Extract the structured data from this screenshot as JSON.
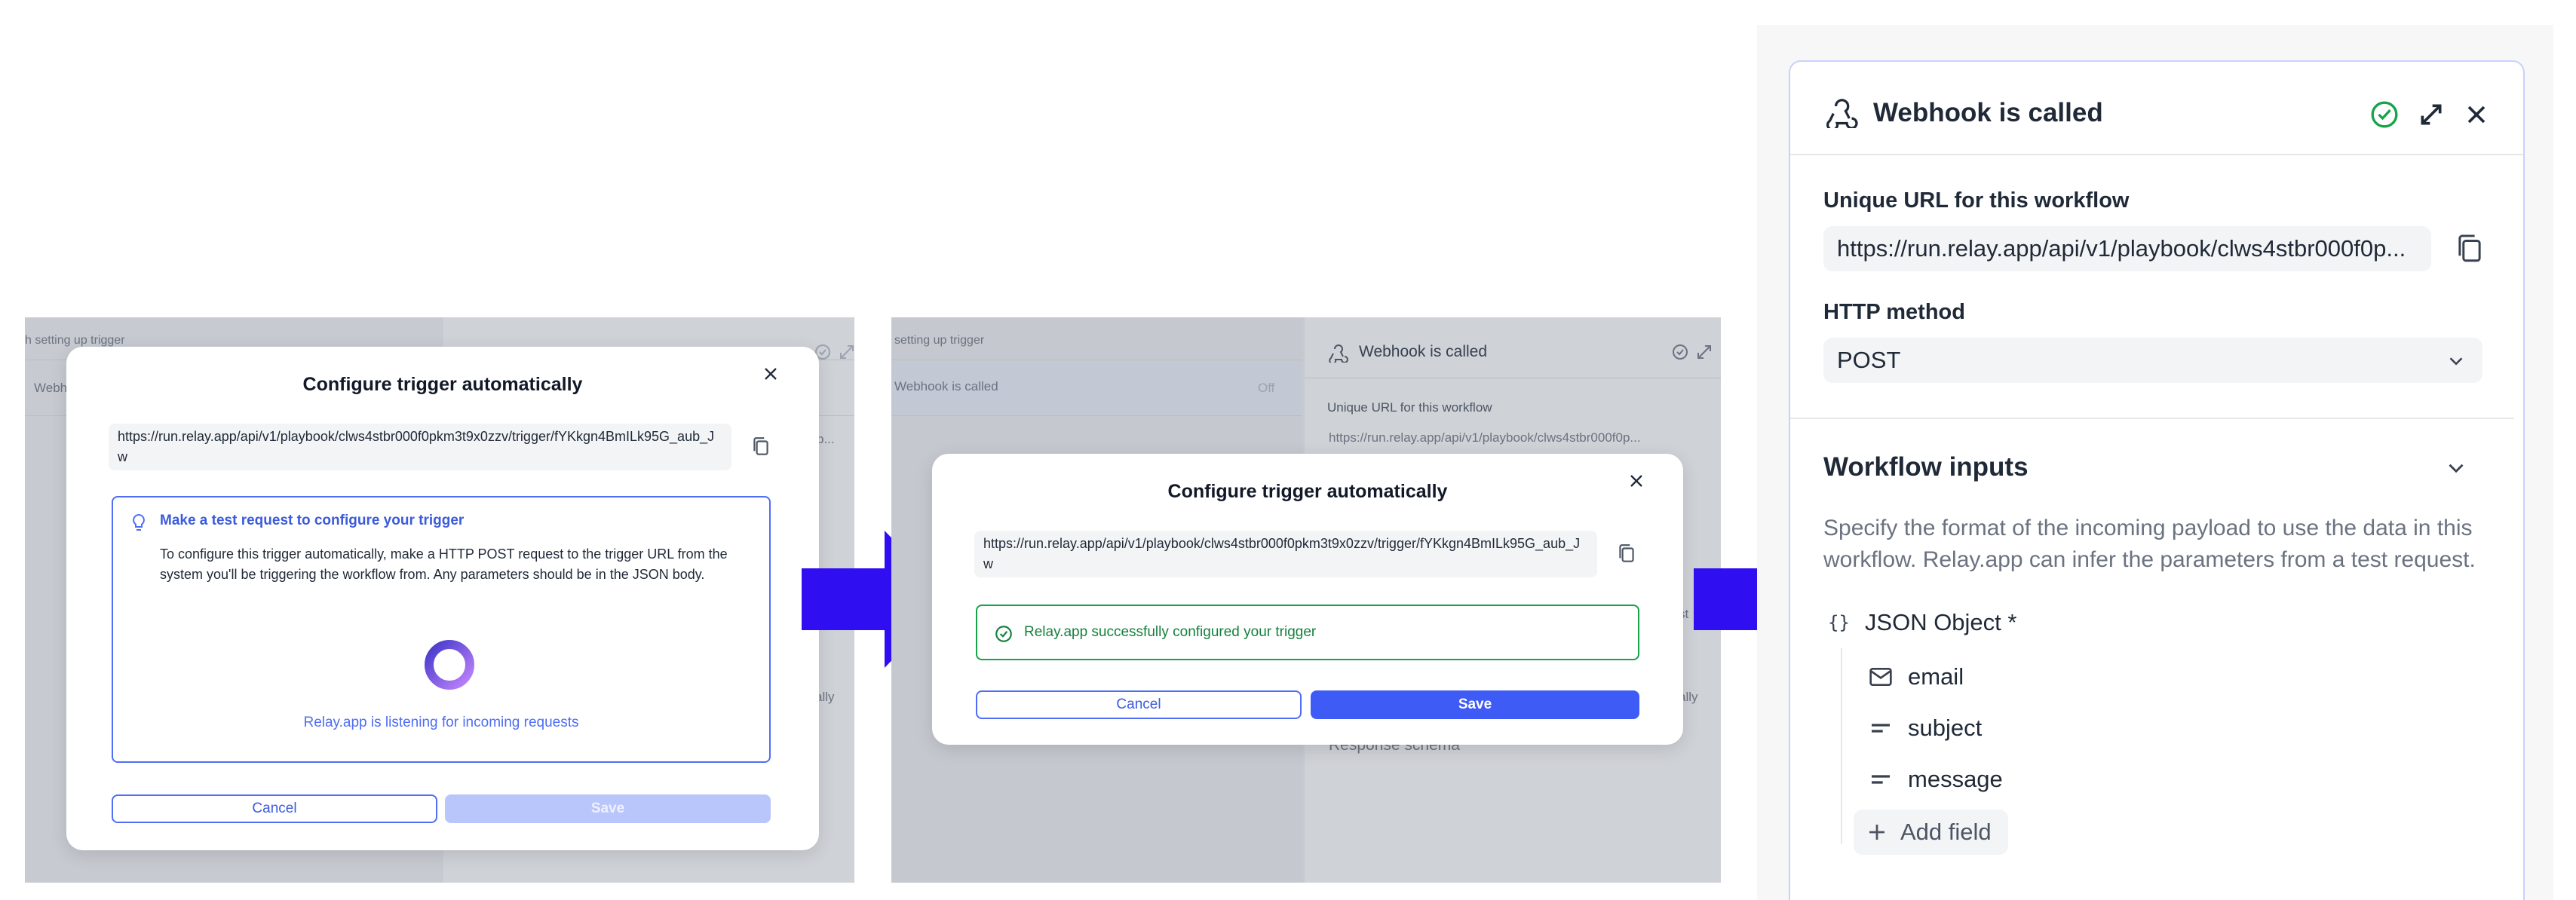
{
  "colors": {
    "accent": "#3f5bf6",
    "arrow": "#2f0ef2",
    "success": "#16a34a",
    "backdrop": "#c7cbd1"
  },
  "step1": {
    "bg": {
      "top_text": "h setting up trigger",
      "row_text": "Webh",
      "right_snip": "p...",
      "side_snip": "ally"
    },
    "modal": {
      "title": "Configure trigger automatically",
      "url": "https://run.relay.app/api/v1/playbook/clws4stbr000f0pkm3t9x0zzv/trigger/fYKkgn4BmILk95G_aub_Jw",
      "info_title": "Make a test request to configure your trigger",
      "info_body": "To configure this trigger automatically, make a HTTP POST request to the trigger URL from the system you'll be triggering the workflow from. Any parameters should be in the JSON body.",
      "listening": "Relay.app is listening for incoming requests",
      "cancel": "Cancel",
      "save": "Save"
    }
  },
  "step2": {
    "bg": {
      "top_text": "setting up trigger",
      "row_text": "Webhook is called",
      "row_status": "Off",
      "panel_title": "Webhook is called",
      "url_label": "Unique URL for this workflow",
      "url_value": "https://run.relay.app/api/v1/playbook/clws4stbr000f0p...",
      "side_snip": "ally",
      "side_snip2": "st",
      "response": "Response schema"
    },
    "modal": {
      "title": "Configure trigger automatically",
      "url": "https://run.relay.app/api/v1/playbook/clws4stbr000f0pkm3t9x0zzv/trigger/fYKkgn4BmILk95G_aub_Jw",
      "success": "Relay.app successfully configured your trigger",
      "cancel": "Cancel",
      "save": "Save"
    }
  },
  "panel": {
    "title": "Webhook is called",
    "url_label": "Unique URL for this workflow",
    "url_value": "https://run.relay.app/api/v1/playbook/clws4stbr000f0p...",
    "method_label": "HTTP method",
    "method_value": "POST",
    "inputs_title": "Workflow inputs",
    "inputs_desc": "Specify the format of the incoming payload to use the data in this workflow. Relay.app can infer the parameters from a test request.",
    "root": "JSON Object *",
    "fields": [
      "email",
      "subject",
      "message"
    ],
    "add_field": "Add field"
  },
  "icons": [
    "close-icon",
    "copy-icon",
    "lightbulb-icon",
    "spinner-icon",
    "check-circle-icon",
    "webhook-icon",
    "expand-icon",
    "chevron-down-icon",
    "braces-icon",
    "mail-icon",
    "text-icon",
    "plus-icon",
    "arrow-right-icon"
  ]
}
